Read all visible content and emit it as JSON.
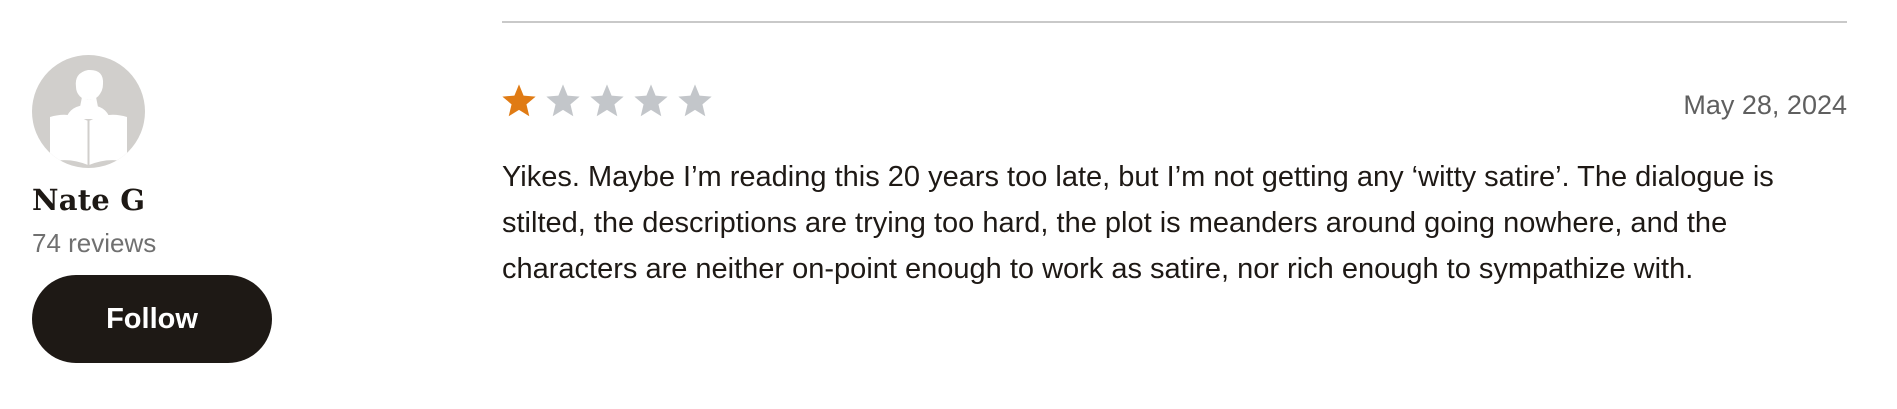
{
  "reviewer": {
    "name": "Nate G",
    "reviews_count": "74 reviews",
    "follow_label": "Follow",
    "avatar_icon": "reader-silhouette-icon"
  },
  "review": {
    "rating": 1,
    "max_rating": 5,
    "date": "May 28, 2024",
    "text": "Yikes. Maybe I’m reading this 20 years too late, but I’m not getting any ‘witty satire’. The dialogue is stilted, the descriptions are trying too hard, the plot is meanders around going nowhere, and the characters are neither on-point enough to work as satire, nor rich enough to sympathize with."
  },
  "colors": {
    "star_filled": "#e07b14",
    "star_empty": "#c3c6ca",
    "button_bg": "#1e1915",
    "avatar_bg": "#d1cfcc"
  }
}
